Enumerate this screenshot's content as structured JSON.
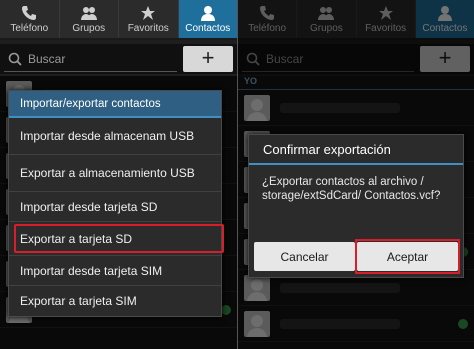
{
  "tabs": [
    {
      "label": "Teléfono",
      "icon": "phone-icon"
    },
    {
      "label": "Grupos",
      "icon": "groups-icon"
    },
    {
      "label": "Favoritos",
      "icon": "star-icon"
    },
    {
      "label": "Contactos",
      "icon": "contact-icon"
    }
  ],
  "search": {
    "placeholder": "Buscar",
    "add_label": "+"
  },
  "list": {
    "section_label": "YO"
  },
  "menu": {
    "title": "Importar/exportar contactos",
    "items": [
      {
        "label": "Importar desde almacenam USB"
      },
      {
        "label": "Exportar a almacenamiento USB"
      },
      {
        "label": "Importar desde tarjeta SD"
      },
      {
        "label": "Exportar a tarjeta SD"
      },
      {
        "label": "Importar desde tarjeta SIM"
      },
      {
        "label": "Exportar a tarjeta SIM"
      }
    ]
  },
  "dialog": {
    "title": "Confirmar exportación",
    "message": "¿Exportar contactos al archivo / storage/extSdCard/ Contactos.vcf?",
    "cancel": "Cancelar",
    "accept": "Aceptar"
  },
  "colors": {
    "highlight": "#d61f2b",
    "accent": "#3d8fc4",
    "active_tab": "#1f6f9c"
  }
}
